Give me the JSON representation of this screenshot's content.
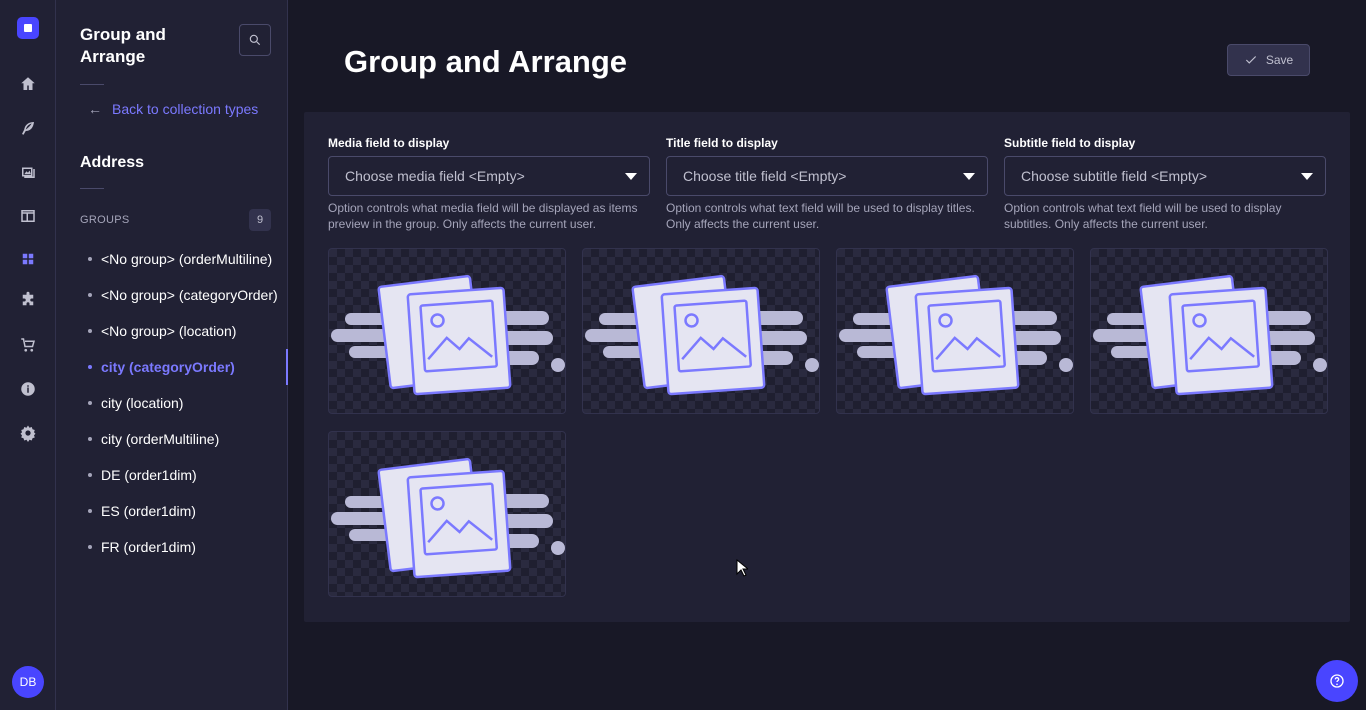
{
  "rail": {
    "avatar_initials": "DB",
    "items": [
      {
        "icon": "home-icon"
      },
      {
        "icon": "feather-icon"
      },
      {
        "icon": "media-library-icon"
      },
      {
        "icon": "layout-icon"
      },
      {
        "icon": "grid-icon",
        "active": true
      },
      {
        "icon": "puzzle-icon"
      },
      {
        "icon": "cart-icon"
      },
      {
        "icon": "info-icon"
      },
      {
        "icon": "gear-icon"
      }
    ]
  },
  "subnav": {
    "title": "Group and Arrange",
    "back_link": "Back to collection types",
    "section_name": "Address",
    "groups_label": "GROUPS",
    "groups_count": "9",
    "groups": [
      {
        "label": "<No group> (orderMultiline)"
      },
      {
        "label": "<No group> (categoryOrder)"
      },
      {
        "label": "<No group> (location)"
      },
      {
        "label": "city (categoryOrder)",
        "active": true
      },
      {
        "label": "city (location)"
      },
      {
        "label": "city (orderMultiline)"
      },
      {
        "label": "DE (order1dim)"
      },
      {
        "label": "ES (order1dim)"
      },
      {
        "label": "FR (order1dim)"
      }
    ]
  },
  "main": {
    "title": "Group and Arrange",
    "save_label": "Save",
    "fields": [
      {
        "label": "Media field to display",
        "value": "Choose media field <Empty>",
        "hint": "Option controls what media field will be displayed as items preview in the group. Only affects the current user."
      },
      {
        "label": "Title field to display",
        "value": "Choose title field <Empty>",
        "hint": "Option controls what text field will be used to display titles. Only affects the current user."
      },
      {
        "label": "Subtitle field to display",
        "value": "Choose subtitle field <Empty>",
        "hint": "Option controls what text field will be used to display subtitles. Only affects the current user."
      }
    ],
    "cards_count": 5
  },
  "colors": {
    "accent": "#7b79ff",
    "primary": "#4945ff",
    "background": "#181826",
    "surface": "#212134"
  }
}
